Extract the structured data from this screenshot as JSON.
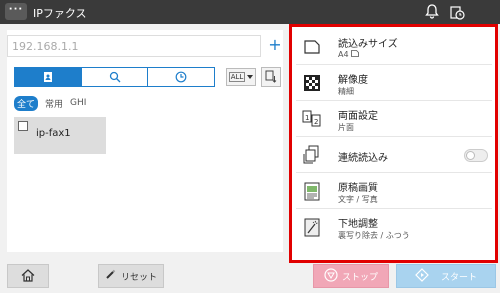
{
  "header": {
    "menu_label": "···",
    "title": "IPファクス",
    "icons": [
      "bell-icon",
      "job-status-icon"
    ]
  },
  "left": {
    "address_value": "192.168.1.1",
    "add_label": "+",
    "search_tabs": [
      "address-book-icon",
      "search-icon",
      "history-icon"
    ],
    "all_dropdown": "ALL",
    "filters": [
      "全て",
      "常用",
      "GHI"
    ],
    "destinations": [
      {
        "name": "ip-fax1"
      }
    ]
  },
  "settings": [
    {
      "label": "読込みサイズ",
      "value": "A4",
      "icon": "scan-size-icon"
    },
    {
      "label": "解像度",
      "value": "精細",
      "icon": "resolution-icon"
    },
    {
      "label": "両面設定",
      "value": "片面",
      "icon": "duplex-icon"
    },
    {
      "label": "連続読込み",
      "value": "",
      "icon": "continuous-scan-icon",
      "toggle": false
    },
    {
      "label": "原稿画質",
      "value": "文字 / 写真",
      "icon": "original-quality-icon"
    },
    {
      "label": "下地調整",
      "value": "裏写り除去 / ふつう",
      "icon": "background-adjust-icon"
    }
  ],
  "bottom": {
    "reset_label": "リセット",
    "stop_label": "ストップ",
    "start_label": "スタート"
  },
  "colors": {
    "accent": "#1e7ecb",
    "highlight_border": "#e10000",
    "stop": "#f1a7b7",
    "start": "#a9d3ef"
  }
}
